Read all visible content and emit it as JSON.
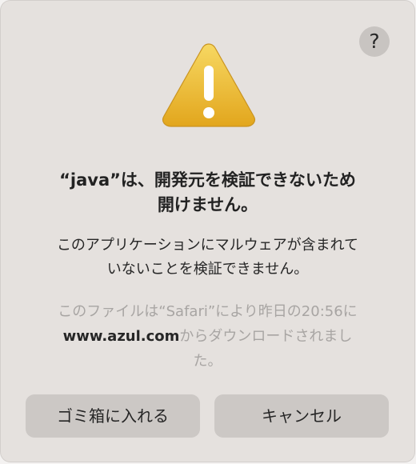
{
  "help_button": {
    "label": "?",
    "icon": "question-mark-icon"
  },
  "warning": {
    "icon": "warning-triangle-icon",
    "symbol": "!",
    "colors": {
      "top": "#f6d45d",
      "bottom": "#e3a91f",
      "mark": "#ffffff"
    }
  },
  "title": {
    "line1": "“java”は、開発元を検証できないため",
    "line2": "開けません。"
  },
  "message": {
    "line1": "このアプリケーションにマルウェアが含まれて",
    "line2": "いないことを検証できません。"
  },
  "info": {
    "prefix": "このファイルは“Safari”により昨日の20:56に",
    "source": "www.azul.com",
    "suffix": "からダウンロードされまし",
    "tail": "た。"
  },
  "buttons": {
    "move_to_trash": "ゴミ箱に入れる",
    "cancel": "キャンセル"
  }
}
